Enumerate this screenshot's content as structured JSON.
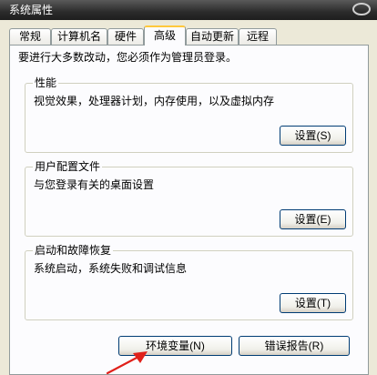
{
  "window": {
    "title": "系统属性"
  },
  "tabs": [
    {
      "label": "常规"
    },
    {
      "label": "计算机名"
    },
    {
      "label": "硬件"
    },
    {
      "label": "高级"
    },
    {
      "label": "自动更新"
    },
    {
      "label": "远程"
    }
  ],
  "active_tab": "高级",
  "intro": "要进行大多数改动，您必须作为管理员登录。",
  "performance": {
    "title": "性能",
    "description": "视觉效果，处理器计划，内存使用，以及虚拟内存",
    "button": "设置(S)"
  },
  "user_profiles": {
    "title": "用户配置文件",
    "description": "与您登录有关的桌面设置",
    "button": "设置(E)"
  },
  "startup_recovery": {
    "title": "启动和故障恢复",
    "description": "系统启动，系统失败和调试信息",
    "button": "设置(T)"
  },
  "footer": {
    "env_vars": "环境变量(N)",
    "error_report": "错误报告(R)"
  },
  "colors": {
    "annotation_arrow": "#e0201a",
    "active_tab_highlight": "#ffc83c"
  }
}
